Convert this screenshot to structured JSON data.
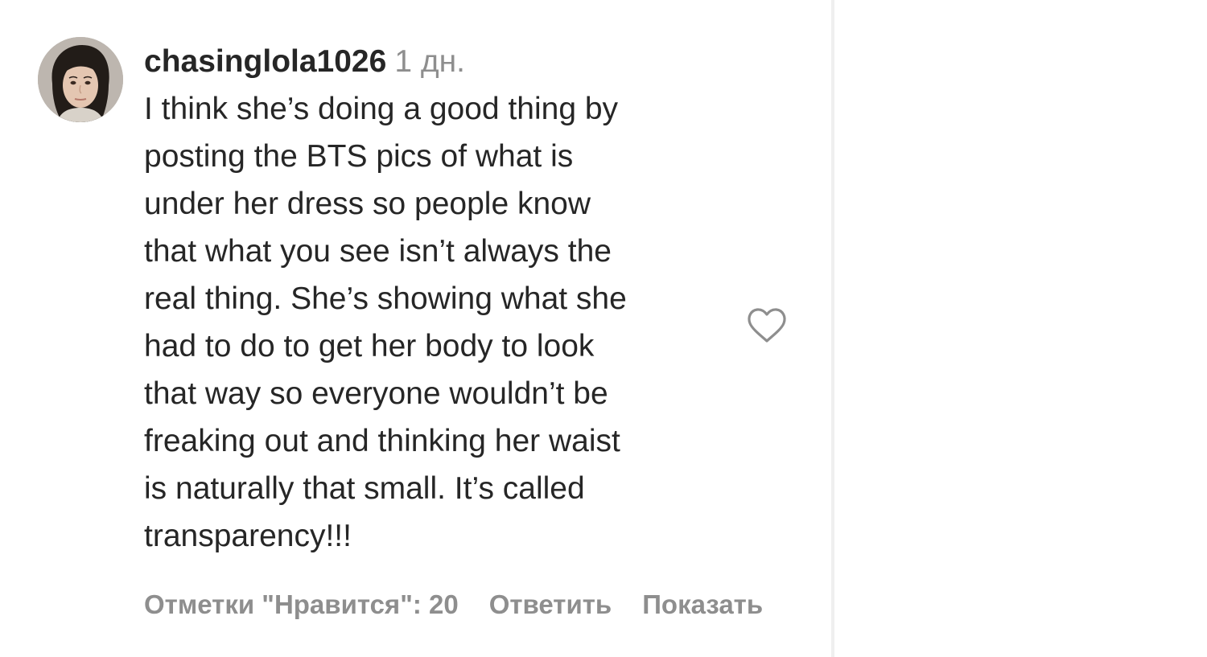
{
  "comment": {
    "username": "chasinglola1026",
    "timestamp": "1 дн.",
    "text_lines": [
      "I think she’s doing a good thing by",
      "posting the BTS pics of what is",
      "under her dress so people know",
      "that what you see isn’t always the",
      "real thing. She’s showing what she",
      "had to do to get her body to look",
      "that way so everyone wouldn’t be",
      "freaking out and thinking her waist",
      "is naturally that small. It’s called",
      "transparency!!!"
    ],
    "likes_label": "Отметки \"Нравится\": 20",
    "reply_label": "Ответить",
    "show_label": "Показать"
  },
  "icons": {
    "avatar": "user-avatar",
    "like": "heart-icon"
  },
  "colors": {
    "text_primary": "#262626",
    "text_secondary": "#8e8e8e",
    "divider": "#efefef",
    "background": "#ffffff"
  }
}
